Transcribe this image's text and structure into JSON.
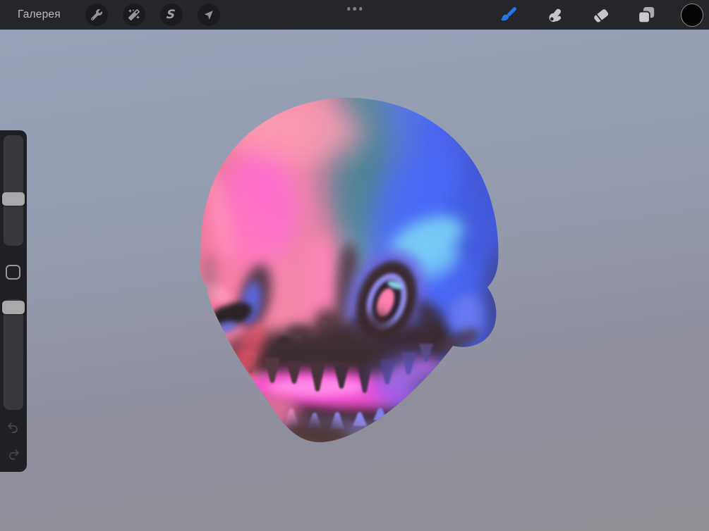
{
  "toolbar": {
    "gallery_label": "Галерея",
    "selection_glyph": "S",
    "left_tools": [
      {
        "id": "actions",
        "icon": "wrench-icon"
      },
      {
        "id": "adjustments",
        "icon": "magic-wand-icon"
      },
      {
        "id": "selection",
        "icon": "s-curve-icon"
      },
      {
        "id": "transform",
        "icon": "arrow-cursor-icon"
      }
    ],
    "right_tools": [
      {
        "id": "paint",
        "icon": "brush-icon",
        "active": true
      },
      {
        "id": "smudge",
        "icon": "smudge-finger-icon",
        "active": false
      },
      {
        "id": "erase",
        "icon": "eraser-icon",
        "active": false
      },
      {
        "id": "layers",
        "icon": "layers-icon",
        "active": false
      },
      {
        "id": "color",
        "icon": "color-swatch",
        "active": false
      }
    ],
    "accent_color": "#2577e8",
    "current_color": "#000000",
    "multitask_indicator_dots": 3
  },
  "sidebar": {
    "brush_size_percent": 42,
    "opacity_percent": 97,
    "controls": [
      "brush-size-slider",
      "modify-button",
      "opacity-slider",
      "undo-button",
      "redo-button"
    ]
  },
  "canvas": {
    "description": "3D sculpted skull model painted with pink-to-blue gradient lighting on a gray-violet backdrop",
    "background_gradient_top": "#98a2b6",
    "background_gradient_bottom": "#918d94",
    "skull_palette": {
      "pink": "#f58aa8",
      "hot_magenta": "#ff66dd",
      "teal": "#6e98ab",
      "blue": "#4b68f2",
      "cyan": "#7fd9f7",
      "socket_shadow": "#3a2b31",
      "mouth_glow": "#fd4fd8"
    }
  }
}
